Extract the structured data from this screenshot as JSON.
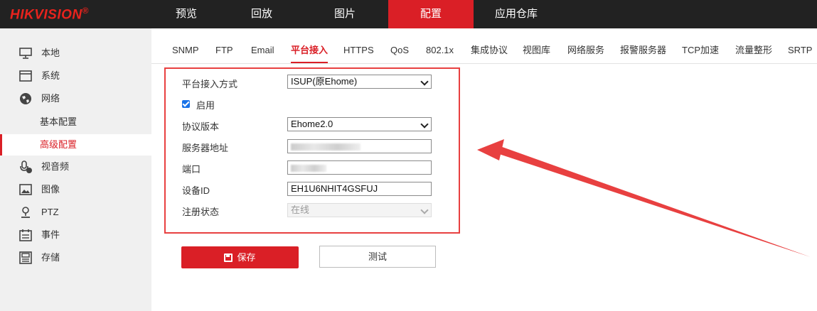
{
  "brand": {
    "name": "HIKVISION",
    "mark": "®",
    "color": "#e8231d"
  },
  "nav": [
    {
      "label": "预览"
    },
    {
      "label": "回放"
    },
    {
      "label": "图片"
    },
    {
      "label": "配置",
      "active": true
    },
    {
      "label": "应用仓库"
    }
  ],
  "sidebar": {
    "items": [
      {
        "label": "本地",
        "icon": "monitor-icon"
      },
      {
        "label": "系统",
        "icon": "window-icon"
      },
      {
        "label": "网络",
        "icon": "globe-icon"
      },
      {
        "label": "基本配置"
      },
      {
        "label": "高级配置",
        "active": true
      },
      {
        "label": "视音频",
        "icon": "microphone-icon"
      },
      {
        "label": "图像",
        "icon": "image-icon"
      },
      {
        "label": "PTZ",
        "icon": "ptz-icon"
      },
      {
        "label": "事件",
        "icon": "calendar-icon"
      },
      {
        "label": "存储",
        "icon": "storage-icon"
      }
    ]
  },
  "tabs": [
    {
      "label": "SNMP"
    },
    {
      "label": "FTP"
    },
    {
      "label": "Email"
    },
    {
      "label": "平台接入",
      "active": true
    },
    {
      "label": "HTTPS"
    },
    {
      "label": "QoS"
    },
    {
      "label": "802.1x"
    },
    {
      "label": "集成协议"
    },
    {
      "label": "视图库"
    },
    {
      "label": "网络服务"
    },
    {
      "label": "报警服务器"
    },
    {
      "label": "TCP加速"
    },
    {
      "label": "流量整形"
    },
    {
      "label": "SRTP"
    }
  ],
  "form": {
    "access_mode": {
      "label": "平台接入方式",
      "value": "ISUP(原Ehome)"
    },
    "enable": {
      "label": "启用",
      "checked": true
    },
    "protocol_version": {
      "label": "协议版本",
      "value": "Ehome2.0"
    },
    "server_address": {
      "label": "服务器地址"
    },
    "port": {
      "label": "端口"
    },
    "device_id": {
      "label": "设备ID",
      "value": "EH1U6NHIT4GSFUJ"
    },
    "register_status": {
      "label": "注册状态",
      "value": "在线"
    }
  },
  "buttons": {
    "save": "保存",
    "test": "测试"
  },
  "colors": {
    "accent": "#da1f26",
    "annotation": "#e84040"
  }
}
